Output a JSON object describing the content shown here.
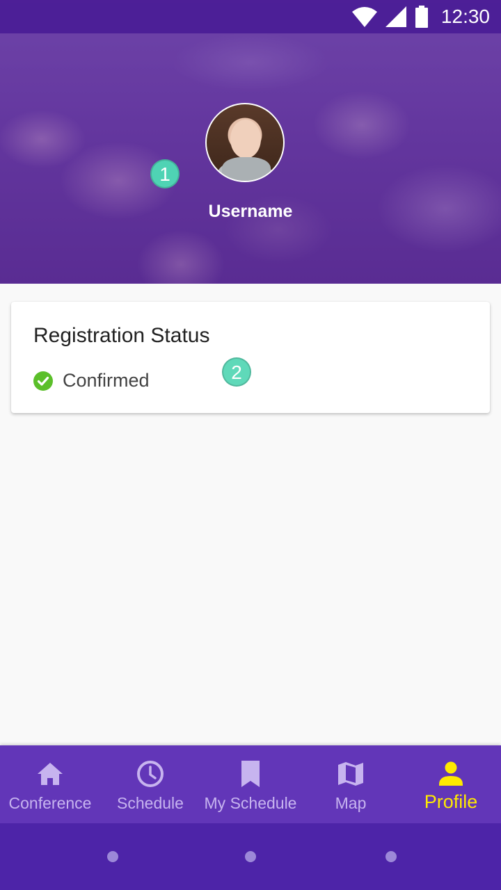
{
  "status_bar": {
    "time": "12:30",
    "icons": [
      "wifi-icon",
      "signal-icon",
      "battery-icon"
    ]
  },
  "profile": {
    "username": "Username",
    "avatar": "avatar-photo"
  },
  "markers": {
    "first": "1",
    "second": "2"
  },
  "registration": {
    "title": "Registration Status",
    "status": "Confirmed",
    "status_color": "#5bbf2a"
  },
  "bottom_nav": {
    "items": [
      {
        "label": "Conference",
        "icon": "home-icon"
      },
      {
        "label": "Schedule",
        "icon": "clock-icon"
      },
      {
        "label": "My Schedule",
        "icon": "bookmark-icon"
      },
      {
        "label": "Map",
        "icon": "map-icon"
      },
      {
        "label": "Profile",
        "icon": "person-icon",
        "active": true
      }
    ],
    "colors": {
      "background": "#6236b8",
      "inactive": "#c7b4ef",
      "active": "#ffea00"
    }
  }
}
